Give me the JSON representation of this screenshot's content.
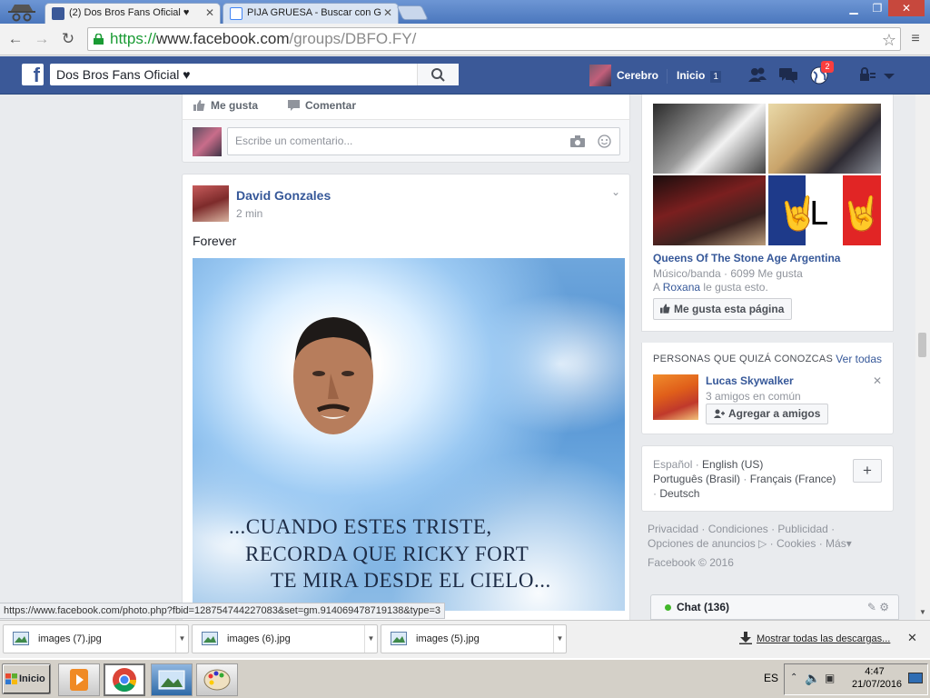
{
  "browser": {
    "tabs": [
      {
        "title": "(2) Dos Bros Fans Oficial ♥",
        "active": true
      },
      {
        "title": "PIJA GRUESA - Buscar con G",
        "active": false
      }
    ],
    "url": {
      "scheme": "https://",
      "host": "www.facebook.com",
      "path": "/groups/DBFO.FY/"
    }
  },
  "fb_header": {
    "search_value": "Dos Bros Fans Oficial ♥",
    "user_name": "Cerebro",
    "home_label": "Inicio",
    "home_count": "1",
    "notifications_badge": "2",
    "brand_color": "#3b5998"
  },
  "prev_post": {
    "like_label": "Me gusta",
    "comment_label": "Comentar",
    "comment_placeholder": "Escribe un comentario..."
  },
  "post": {
    "author": "David Gonzales",
    "time": "2 min",
    "message": "Forever",
    "image_caption": [
      "...CUANDO ESTES TRISTE,",
      "RECORDA QUE RICKY FORT",
      "TE MIRA DESDE EL CIELO..."
    ]
  },
  "page_suggestion": {
    "name": "Queens Of The Stone Age Argentina",
    "meta": "Músico/banda · 6099 Me gusta",
    "liked_prefix": "A ",
    "liked_by": "Roxana",
    "liked_suffix": " le gusta esto.",
    "like_button": "Me gusta esta página"
  },
  "pymk": {
    "header": "PERSONAS QUE QUIZÁ CONOZCAS",
    "see_all": "Ver todas",
    "name": "Lucas Skywalker",
    "mutual": "3 amigos en común",
    "add_button": "Agregar a amigos"
  },
  "languages": {
    "current": "Español",
    "options": [
      "English (US)",
      "Português (Brasil)",
      "Français (France)",
      "Deutsch"
    ]
  },
  "footer": {
    "links": [
      "Privacidad",
      "Condiciones",
      "Publicidad",
      "Opciones de anuncios",
      "Cookies",
      "Más"
    ],
    "copyright": "Facebook © 2016"
  },
  "chat": {
    "label": "Chat (136)"
  },
  "status_url": "https://www.facebook.com/photo.php?fbid=128754744227083&set=gm.914069478719138&type=3",
  "downloads": {
    "items": [
      "images (7).jpg",
      "images (6).jpg",
      "images (5).jpg"
    ],
    "show_all": "Mostrar todas las descargas..."
  },
  "taskbar": {
    "start_label": "Inicio",
    "language": "ES",
    "time": "4:47",
    "date": "21/07/2016"
  }
}
